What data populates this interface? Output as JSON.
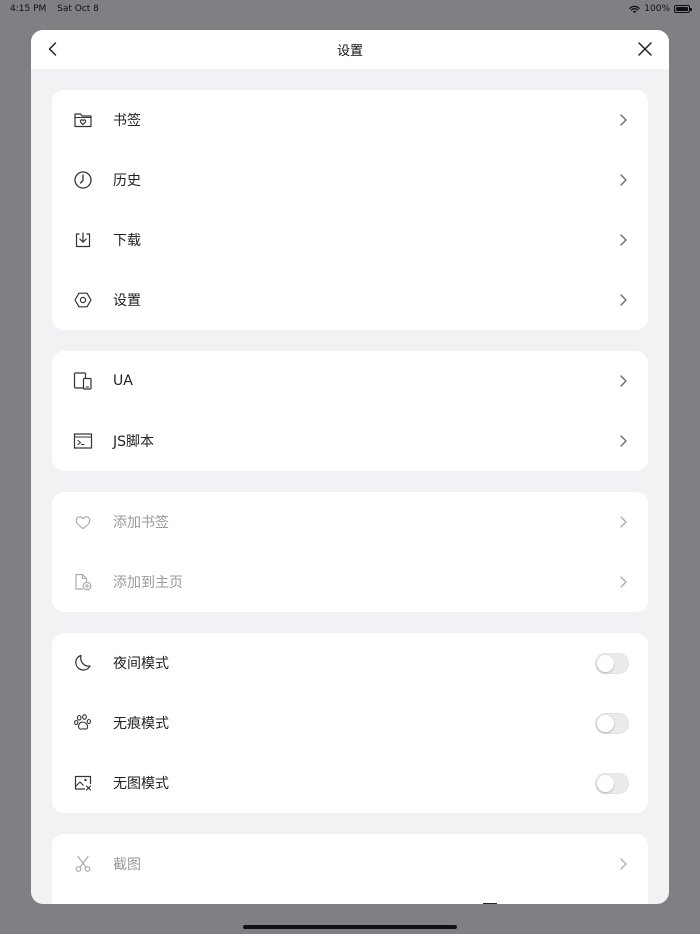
{
  "status_bar": {
    "time": "4:15 PM",
    "date": "Sat Oct 8",
    "battery": "100%",
    "battery_level": 1.0
  },
  "nav": {
    "title": "设置",
    "back_icon": "chevron-left-icon",
    "close_icon": "close-icon"
  },
  "groups": [
    {
      "items": [
        {
          "label": "书签",
          "icon": "bookmark-folder-icon"
        },
        {
          "label": "历史",
          "icon": "clock-icon"
        },
        {
          "label": "下载",
          "icon": "download-icon"
        },
        {
          "label": "设置",
          "icon": "settings-hexagon-icon"
        }
      ]
    },
    {
      "items": [
        {
          "label": "UA",
          "icon": "devices-icon"
        },
        {
          "label": "JS脚本",
          "icon": "terminal-icon"
        }
      ]
    },
    {
      "items": [
        {
          "label": "添加书签",
          "icon": "heart-icon",
          "disabled": true
        },
        {
          "label": "添加到主页",
          "icon": "add-to-home-icon",
          "disabled": true
        }
      ]
    },
    {
      "items": [
        {
          "label": "夜间模式",
          "icon": "moon-icon",
          "toggle": false
        },
        {
          "label": "无痕模式",
          "icon": "paw-icon",
          "toggle": false
        },
        {
          "label": "无图模式",
          "icon": "no-image-icon",
          "toggle": false
        }
      ]
    },
    {
      "items": [
        {
          "label": "截图",
          "icon": "scissors-icon",
          "disabled": true
        }
      ]
    }
  ]
}
